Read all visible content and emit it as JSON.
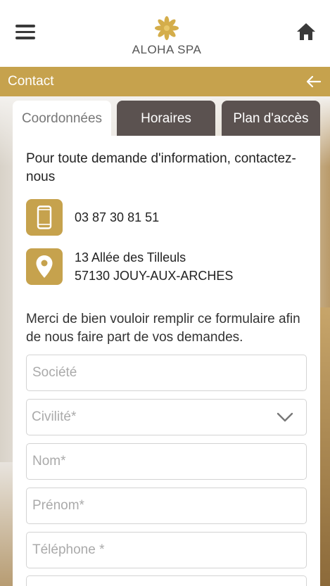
{
  "header": {
    "brand": "ALOHA SPA",
    "icons": {
      "menu": "hamburger-menu-icon",
      "home": "home-icon",
      "logo": "lotus-flower-icon"
    }
  },
  "title_bar": {
    "label": "Contact",
    "back_icon": "arrow-left-icon"
  },
  "tabs": [
    {
      "label": "Coordonnées",
      "active": true
    },
    {
      "label": "Horaires",
      "active": false
    },
    {
      "label": "Plan d'accès",
      "active": false
    }
  ],
  "contact": {
    "intro": "Pour toute demande d'information, contactez-nous",
    "phone": "03 87 30 81 51",
    "address_line1": "13 Allée des Tilleuls",
    "address_line2": "57130 JOUY-AUX-ARCHES",
    "phone_icon": "smartphone-icon",
    "address_icon": "map-pin-icon"
  },
  "form": {
    "note": "Merci de bien vouloir remplir ce formulaire afin de nous faire part de vos demandes.",
    "company_placeholder": "Société",
    "civility_placeholder": "Civilité*",
    "lastname_placeholder": "Nom*",
    "firstname_placeholder": "Prénom*",
    "phone_placeholder": "Téléphone *"
  },
  "colors": {
    "gold": "#c6a24d",
    "tab_inactive": "#5b5250",
    "text": "#222222"
  }
}
